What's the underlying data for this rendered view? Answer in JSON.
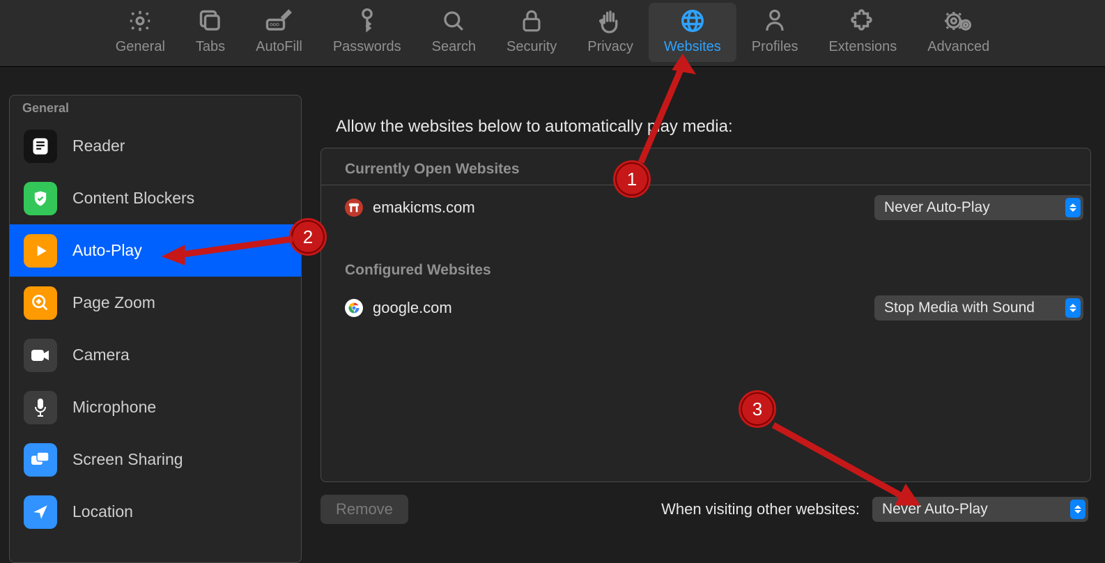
{
  "toolbar": [
    {
      "id": "general",
      "label": "General"
    },
    {
      "id": "tabs",
      "label": "Tabs"
    },
    {
      "id": "autofill",
      "label": "AutoFill"
    },
    {
      "id": "passwords",
      "label": "Passwords"
    },
    {
      "id": "search",
      "label": "Search"
    },
    {
      "id": "security",
      "label": "Security"
    },
    {
      "id": "privacy",
      "label": "Privacy"
    },
    {
      "id": "websites",
      "label": "Websites",
      "active": true
    },
    {
      "id": "profiles",
      "label": "Profiles"
    },
    {
      "id": "extensions",
      "label": "Extensions"
    },
    {
      "id": "advanced",
      "label": "Advanced"
    }
  ],
  "sidebar": {
    "header": "General",
    "items": [
      {
        "id": "reader",
        "label": "Reader"
      },
      {
        "id": "content-blockers",
        "label": "Content Blockers"
      },
      {
        "id": "auto-play",
        "label": "Auto-Play",
        "selected": true
      },
      {
        "id": "page-zoom",
        "label": "Page Zoom"
      },
      {
        "id": "camera",
        "label": "Camera"
      },
      {
        "id": "microphone",
        "label": "Microphone"
      },
      {
        "id": "screen-sharing",
        "label": "Screen Sharing"
      },
      {
        "id": "location",
        "label": "Location"
      }
    ]
  },
  "main": {
    "heading": "Allow the websites below to automatically play media:",
    "sections": {
      "open_header": "Currently Open Websites",
      "configured_header": "Configured Websites"
    },
    "open_sites": [
      {
        "domain": "emakicms.com",
        "setting": "Never Auto-Play"
      }
    ],
    "configured_sites": [
      {
        "domain": "google.com",
        "setting": "Stop Media with Sound"
      }
    ],
    "remove_label": "Remove",
    "other_label": "When visiting other websites:",
    "other_value": "Never Auto-Play"
  },
  "annotations": {
    "b1": "1",
    "b2": "2",
    "b3": "3"
  }
}
